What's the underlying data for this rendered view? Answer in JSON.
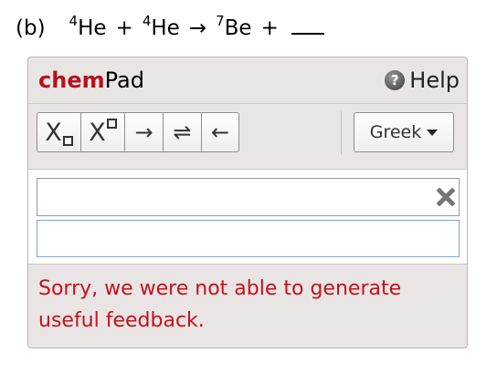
{
  "question": {
    "part": "(b)",
    "reactant1_mass": "4",
    "reactant1_symbol": "He",
    "plus1": "+",
    "reactant2_mass": "4",
    "reactant2_symbol": "He",
    "arrow": "→",
    "product1_mass": "7",
    "product1_symbol": "Be",
    "plus2": "+"
  },
  "chempad": {
    "title_chem": "chem",
    "title_pad": "Pad",
    "help_label": "Help",
    "help_icon": "question-mark-icon",
    "toolbar": {
      "subscript_letter": "X",
      "superscript_letter": "X",
      "reaction_arrow": "→",
      "equilibrium_arrow": "⇌",
      "reverse_arrow": "←",
      "greek_label": "Greek"
    },
    "clear_icon": "close-x-icon",
    "feedback_message": "Sorry, we were not able to generate useful feedback."
  },
  "colors": {
    "brand_red": "#b5121b",
    "feedback_red": "#c4121c",
    "panel_bg": "#e8e5e4",
    "preview_border": "#7fa8c8"
  }
}
